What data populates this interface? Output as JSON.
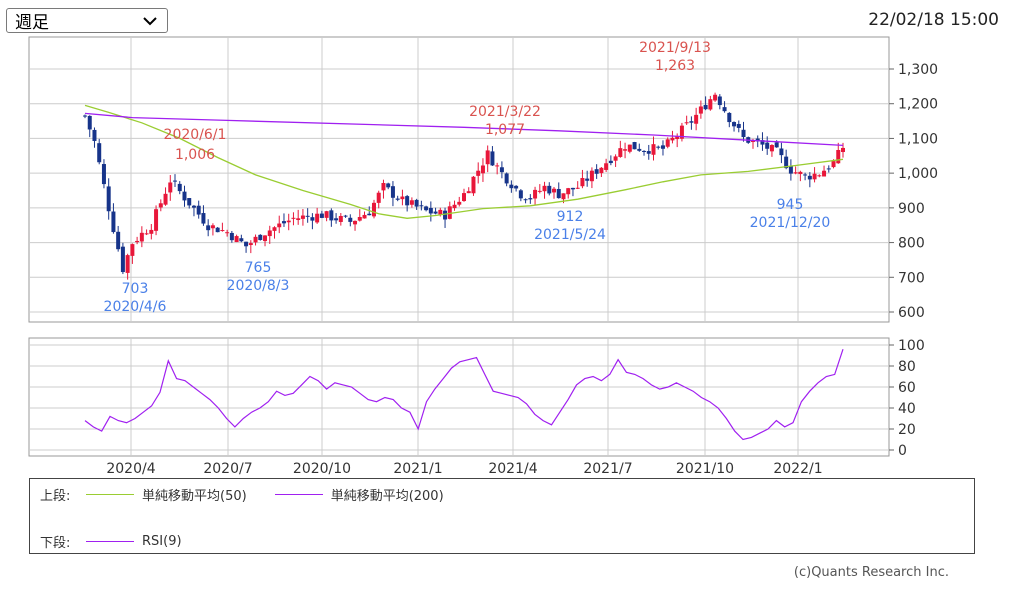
{
  "toolbar": {
    "period_value": "週足",
    "timestamp": "22/02/18 15:00"
  },
  "colors": {
    "up": "#e8173a",
    "down": "#17348a",
    "sma50": "#9acd32",
    "sma200": "#a020f0",
    "rsi": "#a020f0",
    "high_label": "#d9534f",
    "low_label": "#4a80e8"
  },
  "chart_data": [
    {
      "type": "candlestick",
      "xaxis_ticks": [
        "2020/4",
        "2020/7",
        "2020/10",
        "2021/1",
        "2021/4",
        "2021/7",
        "2021/10",
        "2022/1"
      ],
      "x_start": "2020/2/3",
      "x_end": "2022/2/14",
      "ylim": [
        600,
        1300
      ],
      "yticks": [
        "600",
        "700",
        "800",
        "900",
        "1,000",
        "1,100",
        "1,200",
        "1,300"
      ],
      "series": [
        {
          "name": "単純移動平均(50)",
          "type": "line",
          "points": [
            [
              0,
              1195
            ],
            [
              5,
              1175
            ],
            [
              12,
              1145
            ],
            [
              20,
              1100
            ],
            [
              28,
              1045
            ],
            [
              36,
              995
            ],
            [
              46,
              950
            ],
            [
              56,
              910
            ],
            [
              62,
              883
            ],
            [
              68,
              870
            ],
            [
              74,
              878
            ],
            [
              84,
              898
            ],
            [
              94,
              906
            ],
            [
              104,
              925
            ],
            [
              114,
              952
            ],
            [
              122,
              975
            ],
            [
              130,
              995
            ],
            [
              140,
              1005
            ],
            [
              150,
              1022
            ],
            [
              160,
              1040
            ]
          ]
        },
        {
          "name": "単純移動平均(200)",
          "type": "line",
          "points": [
            [
              0,
              1172
            ],
            [
              10,
              1160
            ],
            [
              30,
              1152
            ],
            [
              60,
              1140
            ],
            [
              80,
              1132
            ],
            [
              100,
              1122
            ],
            [
              120,
              1110
            ],
            [
              140,
              1095
            ],
            [
              160,
              1080
            ]
          ]
        }
      ],
      "annotations": [
        {
          "date": "2021/9/13",
          "value": "1,263",
          "kind": "high",
          "index": 133
        },
        {
          "date": "2021/3/22",
          "value": "1,077",
          "kind": "high",
          "index": 85
        },
        {
          "date": "2020/6/1",
          "value": "1,006",
          "kind": "high",
          "index": 18
        },
        {
          "date": "2020/4/6",
          "value": "703",
          "kind": "low",
          "index": 8
        },
        {
          "date": "2020/8/3",
          "value": "765",
          "kind": "low",
          "index": 34
        },
        {
          "date": "2021/5/24",
          "value": "912",
          "kind": "low",
          "index": 94
        },
        {
          "date": "2021/12/20",
          "value": "945",
          "kind": "low",
          "index": 150
        }
      ]
    },
    {
      "type": "line",
      "name": "RSI(9)",
      "ylim": [
        0,
        100
      ],
      "yticks": [
        "0",
        "20",
        "40",
        "60",
        "80",
        "100"
      ],
      "y": [
        28,
        22,
        18,
        32,
        28,
        26,
        30,
        36,
        42,
        55,
        85,
        68,
        66,
        60,
        54,
        48,
        40,
        30,
        22,
        30,
        36,
        40,
        46,
        56,
        52,
        54,
        62,
        70,
        66,
        58,
        64,
        62,
        60,
        54,
        48,
        46,
        50,
        48,
        40,
        36,
        20,
        46,
        58,
        68,
        78,
        84,
        86,
        88,
        72,
        56,
        54,
        52,
        50,
        44,
        34,
        28,
        24,
        36,
        48,
        62,
        68,
        70,
        66,
        72,
        86,
        74,
        72,
        68,
        62,
        58,
        60,
        64,
        60,
        56,
        50,
        46,
        40,
        30,
        18,
        10,
        12,
        16,
        20,
        28,
        22,
        26,
        46,
        56,
        64,
        70,
        72,
        96
      ]
    }
  ],
  "legend": {
    "upper_label": "上段:",
    "lower_label": "下段:",
    "items_upper": [
      "単純移動平均(50)",
      "単純移動平均(200)"
    ],
    "items_lower": [
      "RSI(9)"
    ]
  },
  "footer": {
    "copyright": "(c)Quants Research Inc."
  }
}
